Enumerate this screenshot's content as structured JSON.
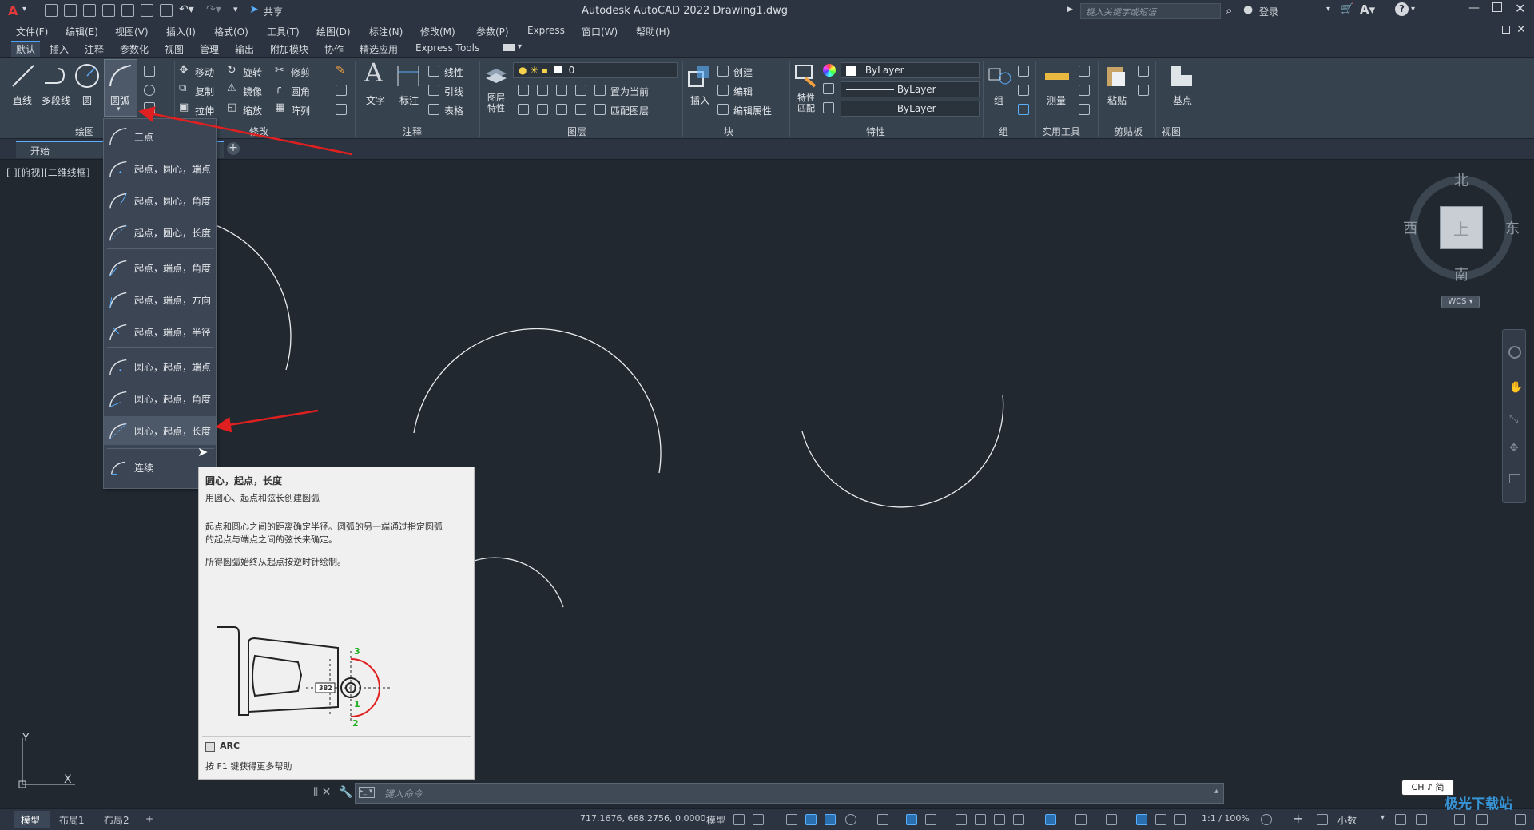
{
  "app": {
    "title": "Autodesk AutoCAD 2022    Drawing1.dwg",
    "share_label": "共享",
    "search_placeholder": "键入关键字或短语",
    "login_label": "登录"
  },
  "menubar": [
    "文件(F)",
    "编辑(E)",
    "视图(V)",
    "插入(I)",
    "格式(O)",
    "工具(T)",
    "绘图(D)",
    "标注(N)",
    "修改(M)",
    "参数(P)",
    "Express",
    "窗口(W)",
    "帮助(H)"
  ],
  "ribbon_tabs": [
    "默认",
    "插入",
    "注释",
    "参数化",
    "视图",
    "管理",
    "输出",
    "附加模块",
    "协作",
    "精选应用",
    "Express Tools"
  ],
  "ribbon": {
    "draw": {
      "title": "绘图",
      "line": "直线",
      "polyline": "多段线",
      "circle": "圆",
      "arc": "圆弧"
    },
    "modify": {
      "title": "修改",
      "move": "移动",
      "rotate": "旋转",
      "trim": "修剪",
      "copy": "复制",
      "mirror": "镜像",
      "fillet": "圆角",
      "stretch": "拉伸",
      "scale": "缩放",
      "array": "阵列"
    },
    "annotation": {
      "title": "注释",
      "text": "文字",
      "dimension": "标注",
      "linetype": "线性",
      "leader": "引线",
      "table": "表格"
    },
    "layers": {
      "title": "图层",
      "layer_props": "图层\n特性",
      "current_layer": "0",
      "set_current": "置为当前",
      "match_layer": "匹配图层"
    },
    "block": {
      "title": "块",
      "insert": "插入",
      "create": "创建",
      "edit": "编辑",
      "edit_attr": "编辑属性"
    },
    "properties": {
      "title": "特性",
      "match": "特性\n匹配",
      "color": "ByLayer",
      "linetype": "ByLayer",
      "lineweight": "ByLayer"
    },
    "groups": {
      "title": "组",
      "group": "组"
    },
    "utilities": {
      "title": "实用工具",
      "measure": "测量"
    },
    "clipboard": {
      "title": "剪贴板",
      "paste": "粘贴"
    },
    "view": {
      "title": "视图",
      "base": "基点"
    }
  },
  "doc_tab": "开始",
  "viewport_label": "[-][俯视][二维线框]",
  "arc_menu": [
    "三点",
    "起点，圆心，端点",
    "起点，圆心，角度",
    "起点，圆心，长度",
    "起点，端点，角度",
    "起点，端点，方向",
    "起点，端点，半径",
    "圆心，起点，端点",
    "圆心，起点，角度",
    "圆心，起点，长度",
    "连续"
  ],
  "tooltip": {
    "title": "圆心，起点，长度",
    "subtitle": "用圆心、起点和弦长创建圆弧",
    "desc1": "起点和圆心之间的距离确定半径。圆弧的另一端通过指定圆弧",
    "desc2": "的起点与端点之间的弦长来确定。",
    "desc3": "所得圆弧始终从起点按逆时针绘制。",
    "dim_value": "382",
    "pt1": "1",
    "pt2": "2",
    "pt3": "3",
    "command": "ARC",
    "help": "按 F1 键获得更多帮助"
  },
  "viewcube": {
    "north": "北",
    "south": "南",
    "east": "东",
    "west": "西",
    "top": "上",
    "wcs": "WCS"
  },
  "ucs": {
    "x": "X",
    "y": "Y"
  },
  "command_placeholder": "键入命令",
  "status": {
    "tabs": [
      "模型",
      "布局1",
      "布局2"
    ],
    "coords": "717.1676, 668.2756, 0.0000",
    "model": "模型",
    "scale": "1:1 / 100%",
    "units": "小数"
  },
  "ime": "CH ♪ 简",
  "watermark": "极光下载站"
}
